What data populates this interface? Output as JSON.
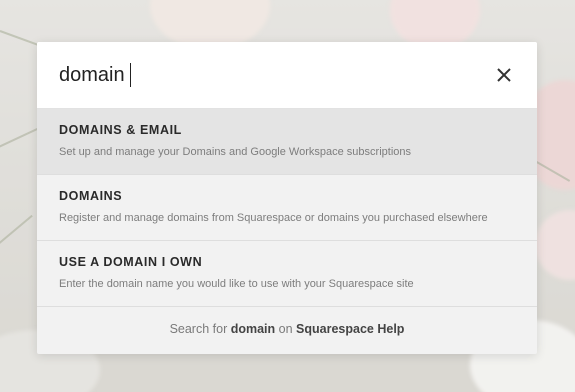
{
  "search": {
    "value": "domain",
    "placeholder": ""
  },
  "close_icon": "close-icon",
  "results": [
    {
      "title": "DOMAINS & EMAIL",
      "description": "Set up and manage your Domains and Google Workspace subscriptions",
      "highlighted": true
    },
    {
      "title": "DOMAINS",
      "description": "Register and manage domains from Squarespace or domains you purchased elsewhere",
      "highlighted": false
    },
    {
      "title": "USE A DOMAIN I OWN",
      "description": "Enter the domain name you would like to use with your Squarespace site",
      "highlighted": false
    }
  ],
  "footer": {
    "prefix": "Search for",
    "query": "domain",
    "middle": "on",
    "link": "Squarespace Help"
  },
  "colors": {
    "highlight_row": "#e4e4e4",
    "modal_bg": "#f2f2f2"
  }
}
